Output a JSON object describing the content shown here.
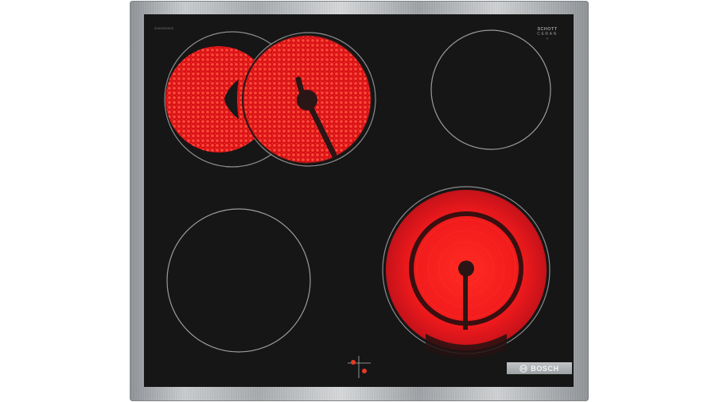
{
  "product": {
    "brand": "BOSCH",
    "glass_maker": {
      "line1": "SCHOTT",
      "line2": "CERAN",
      "line3": "®"
    },
    "serial": "0000000000"
  },
  "colors": {
    "glass": "#161616",
    "frame": "#b5b8bb",
    "glow": "#e0191c",
    "glow_hot": "#ff2a20",
    "ring": "#9a9a9a",
    "plate": "#aeb1b4",
    "indicator": "#e83a25"
  },
  "zones": [
    {
      "name": "dual-zone-rear-left",
      "state": "on"
    },
    {
      "name": "zone-rear-right",
      "state": "off"
    },
    {
      "name": "zone-front-left",
      "state": "off"
    },
    {
      "name": "dual-zone-front-right",
      "state": "on"
    }
  ],
  "indicators": [
    {
      "name": "residual-heat-indicator-1",
      "state": "on"
    },
    {
      "name": "residual-heat-indicator-2",
      "state": "on"
    }
  ]
}
